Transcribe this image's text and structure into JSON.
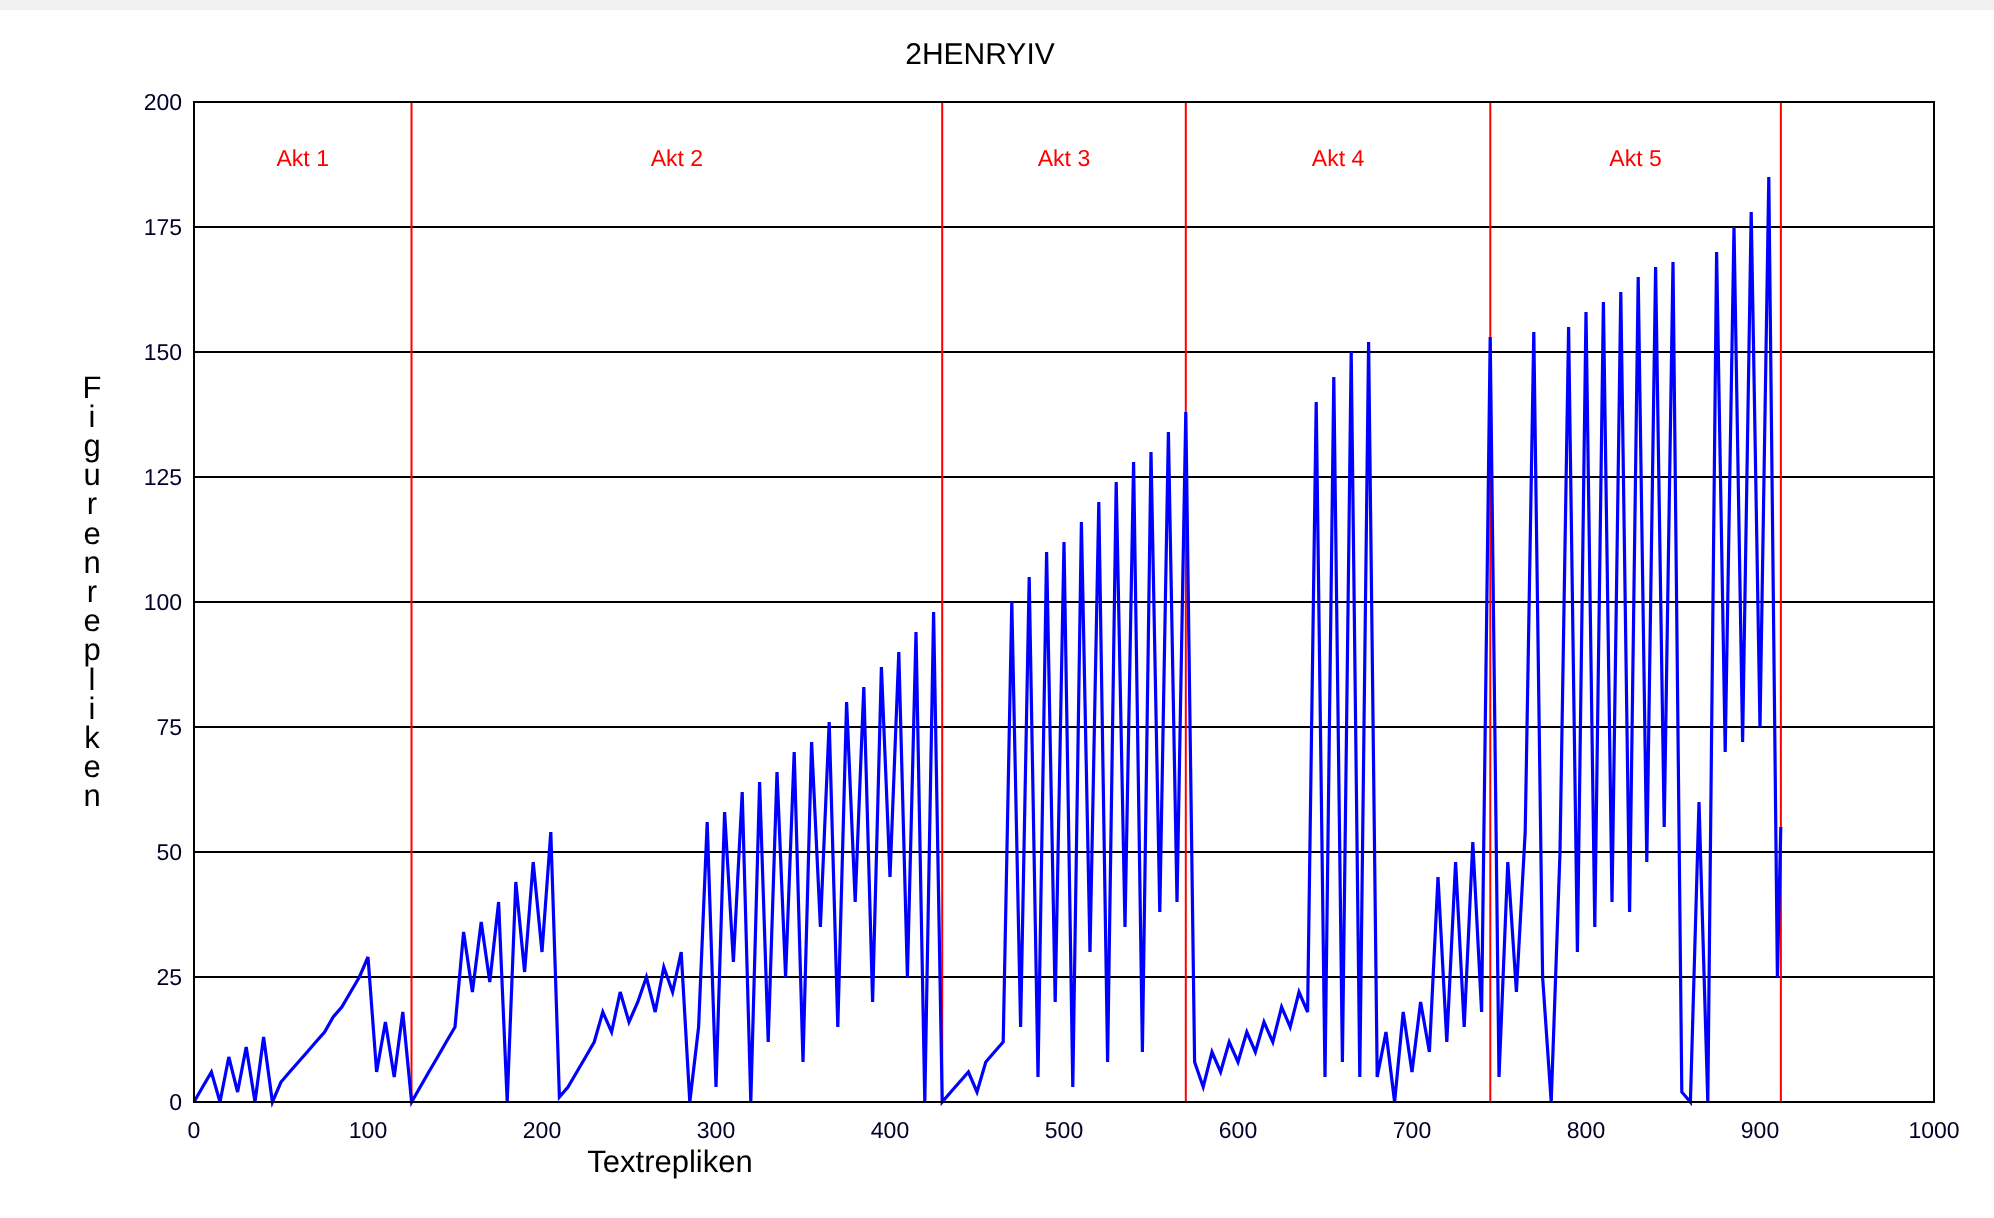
{
  "chart_data": {
    "type": "line",
    "title": "2HENRYIV",
    "xlabel": "Textrepliken",
    "ylabel": "Figurenrepliken",
    "xlim": [
      0,
      1000
    ],
    "ylim": [
      0,
      200
    ],
    "xticks": [
      0,
      100,
      200,
      300,
      400,
      500,
      600,
      700,
      800,
      900,
      1000
    ],
    "yticks": [
      0,
      25,
      50,
      75,
      100,
      125,
      150,
      175,
      200
    ],
    "x": [
      0,
      5,
      10,
      15,
      20,
      25,
      30,
      35,
      40,
      45,
      50,
      55,
      60,
      65,
      70,
      75,
      80,
      85,
      90,
      95,
      100,
      105,
      110,
      115,
      120,
      125,
      130,
      135,
      140,
      145,
      150,
      155,
      160,
      165,
      170,
      175,
      180,
      185,
      190,
      195,
      200,
      205,
      210,
      215,
      220,
      225,
      230,
      235,
      240,
      245,
      250,
      255,
      260,
      265,
      270,
      275,
      280,
      285,
      290,
      295,
      300,
      305,
      310,
      315,
      320,
      325,
      330,
      335,
      340,
      345,
      350,
      355,
      360,
      365,
      370,
      375,
      380,
      385,
      390,
      395,
      400,
      405,
      410,
      415,
      420,
      425,
      430,
      435,
      440,
      445,
      450,
      455,
      460,
      465,
      470,
      475,
      480,
      485,
      490,
      495,
      500,
      505,
      510,
      515,
      520,
      525,
      530,
      535,
      540,
      545,
      550,
      555,
      560,
      565,
      570,
      575,
      580,
      585,
      590,
      595,
      600,
      605,
      610,
      615,
      620,
      625,
      630,
      635,
      640,
      645,
      650,
      655,
      660,
      665,
      670,
      675,
      680,
      685,
      690,
      695,
      700,
      705,
      710,
      715,
      720,
      725,
      730,
      735,
      740,
      745,
      750,
      755,
      760,
      765,
      770,
      775,
      780,
      785,
      790,
      795,
      800,
      805,
      810,
      815,
      820,
      825,
      830,
      835,
      840,
      845,
      850,
      855,
      860,
      865,
      870,
      875,
      880,
      885,
      890,
      895,
      900,
      905,
      910,
      912
    ],
    "series": [
      {
        "color": "#0000ff",
        "values": [
          0,
          3,
          6,
          0,
          9,
          2,
          11,
          0,
          13,
          0,
          4,
          6,
          8,
          10,
          12,
          14,
          17,
          19,
          22,
          25,
          29,
          6,
          16,
          5,
          18,
          0,
          3,
          6,
          9,
          12,
          15,
          34,
          22,
          36,
          24,
          40,
          0,
          44,
          26,
          48,
          30,
          54,
          1,
          3,
          6,
          9,
          12,
          18,
          14,
          22,
          16,
          20,
          25,
          18,
          27,
          22,
          30,
          0,
          15,
          56,
          3,
          58,
          28,
          62,
          0,
          64,
          12,
          66,
          25,
          70,
          8,
          72,
          35,
          76,
          15,
          80,
          40,
          83,
          20,
          87,
          45,
          90,
          25,
          94,
          0,
          98,
          0,
          2,
          4,
          6,
          2,
          8,
          10,
          12,
          100,
          15,
          105,
          5,
          110,
          20,
          112,
          3,
          116,
          30,
          120,
          8,
          124,
          35,
          128,
          10,
          130,
          38,
          134,
          40,
          138,
          8,
          3,
          10,
          6,
          12,
          8,
          14,
          10,
          16,
          12,
          19,
          15,
          22,
          18,
          140,
          5,
          145,
          8,
          150,
          5,
          152,
          5,
          14,
          0,
          18,
          6,
          20,
          10,
          45,
          12,
          48,
          15,
          52,
          18,
          153,
          5,
          48,
          22,
          54,
          154,
          25,
          0,
          50,
          155,
          30,
          158,
          35,
          160,
          40,
          162,
          38,
          165,
          48,
          167,
          55,
          168,
          2,
          0,
          60,
          0,
          170,
          70,
          175,
          72,
          178,
          75,
          185,
          25,
          55
        ]
      }
    ],
    "grid": true,
    "ref_lines": [
      {
        "axis": "x",
        "value": 125,
        "color": "#ff0000"
      },
      {
        "axis": "x",
        "value": 430,
        "color": "#ff0000"
      },
      {
        "axis": "x",
        "value": 570,
        "color": "#ff0000"
      },
      {
        "axis": "x",
        "value": 745,
        "color": "#ff0000"
      },
      {
        "axis": "x",
        "value": 912,
        "color": "#ff0000"
      }
    ],
    "annotations": [
      "Akt 1",
      "Akt 2",
      "Akt 3",
      "Akt 4",
      "Akt 5"
    ]
  }
}
